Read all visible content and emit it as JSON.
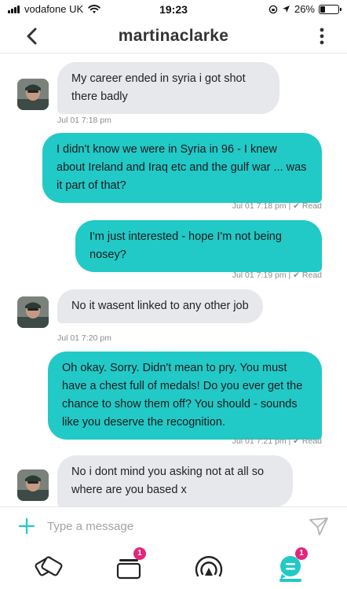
{
  "status_bar": {
    "carrier": "vodafone UK",
    "time": "19:23",
    "battery_percent": "26%",
    "battery_level": 0.26
  },
  "header": {
    "title": "martinaclarke",
    "back_icon": "chevron-left-icon",
    "more_icon": "vertical-dots-icon"
  },
  "messages": [
    {
      "direction": "in",
      "text": "My career ended in syria i got shot there badly",
      "time": "Jul 01 7:18 pm"
    },
    {
      "direction": "out",
      "text": "I didn't know we were in Syria in 96 - I knew about Ireland and Iraq etc and the gulf war ... was it part of that?",
      "time": "Jul 01 7:18 pm",
      "status": "Read"
    },
    {
      "direction": "out",
      "text": "I'm just interested - hope I'm not being nosey?",
      "time": "Jul 01 7:19 pm",
      "status": "Read"
    },
    {
      "direction": "in",
      "text": "No it wasent linked to any other job",
      "time": "Jul 01 7:20 pm"
    },
    {
      "direction": "out",
      "text": "Oh okay. Sorry. Didn't mean to pry. You must have a chest full of medals! Do you ever get the chance to show them off? You should - sounds like you deserve the recognition.",
      "time": "Jul 01 7:21 pm",
      "status": "Read"
    },
    {
      "direction": "in",
      "text": "No i dont mind you asking not at all so where are you based x",
      "time": ""
    }
  ],
  "composer": {
    "placeholder": "Type a message",
    "value": ""
  },
  "bottom_nav": {
    "items": [
      {
        "name": "discover",
        "icon": "cards-icon",
        "badge": ""
      },
      {
        "name": "matches",
        "icon": "stack-icon",
        "badge": "1"
      },
      {
        "name": "live",
        "icon": "broadcast-icon",
        "badge": ""
      },
      {
        "name": "messages",
        "icon": "chat-bubble-icon",
        "badge": "1",
        "active": true
      }
    ]
  },
  "colors": {
    "accent": "#21c9c7",
    "incoming_bubble": "#e7e8ec",
    "badge": "#e3257b",
    "meta_text": "#8c8c8c"
  }
}
